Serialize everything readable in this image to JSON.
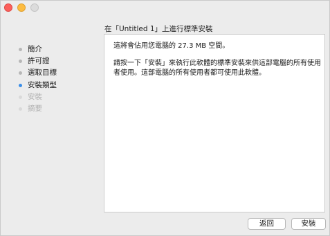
{
  "window": {
    "title": "在「Untitled 1」上進行標準安裝"
  },
  "sidebar": {
    "steps": [
      {
        "label": "簡介",
        "state": "done"
      },
      {
        "label": "許可證",
        "state": "done"
      },
      {
        "label": "選取目標",
        "state": "done"
      },
      {
        "label": "安裝類型",
        "state": "current"
      },
      {
        "label": "安裝",
        "state": "pending"
      },
      {
        "label": "摘要",
        "state": "pending"
      }
    ]
  },
  "content": {
    "line1": "這將會佔用您電腦的 27.3 MB 空間。",
    "line2": "請按一下「安裝」來執行此軟體的標準安裝來供這部電腦的所有使用者使用。這部電腦的所有使用者都可使用此軟體。"
  },
  "buttons": {
    "back": "返回",
    "install": "安裝"
  },
  "colors": {
    "close": "#fc605c",
    "minimize": "#fdbc40",
    "zoom_disabled": "#dcdcdc",
    "current_step": "#3b8ee8",
    "done_step": "#b7b7b7",
    "pending_step": "#d9d9d9"
  }
}
